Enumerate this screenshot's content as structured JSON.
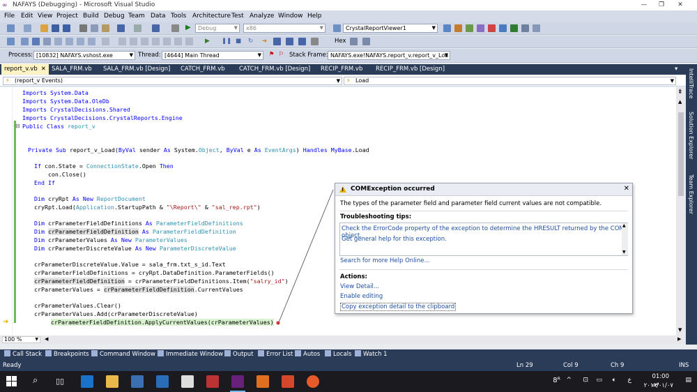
{
  "window": {
    "title": "NAFAYS (Debugging) - Microsoft Visual Studio",
    "min": "—",
    "restore": "❐",
    "close": "✕"
  },
  "menu": [
    "File",
    "Edit",
    "View",
    "Project",
    "Build",
    "Debug",
    "Team",
    "Data",
    "Tools",
    "Architecture",
    "Test",
    "Analyze",
    "Window",
    "Help"
  ],
  "toolbar1": {
    "config": "Debug",
    "platform": "x86",
    "viewer": "CrystalReportViewer1"
  },
  "toolbar2": {
    "hex_label": "Hex"
  },
  "toolbar3": {
    "process_label": "Process:",
    "process_value": "[10832] NAFAYS.vshost.exe",
    "thread_label": "Thread:",
    "thread_value": "[4644] Main Thread",
    "stack_label": "Stack Frame:",
    "stack_value": "NAFAYS.exe!NAFAYS.report_v.report_v_Loa"
  },
  "tabs": [
    {
      "label": "report_v.vb",
      "active": true,
      "close": "✕"
    },
    {
      "label": "SALA_FRM.vb"
    },
    {
      "label": "SALA_FRM.vb [Design]"
    },
    {
      "label": "CATCH_FRM.vb"
    },
    {
      "label": "CATCH_FRM.vb [Design]"
    },
    {
      "label": "RECIP_FRM.vb"
    },
    {
      "label": "RECIP_FRM.vb [Design]"
    }
  ],
  "nav": {
    "left": "(report_v Events)",
    "right": "Load"
  },
  "code": {
    "l1": "Imports System.Data",
    "l2": "Imports System.Data.OleDb",
    "l3": "Imports CrystalDecisions.Shared",
    "l4": "Imports CrystalDecisions.CrystalReports.Engine",
    "l5a": "Public Class ",
    "l5b": "report_v",
    "l6a": "    Private Sub ",
    "l6b": "report_v_Load(",
    "l6c": "ByVal",
    "l6d": " sender ",
    "l6e": "As",
    "l6f": " System.",
    "l6g": "Object",
    "l6h": ", ",
    "l6i": "ByVal",
    "l6j": " e ",
    "l6k": "As",
    "l6l": " ",
    "l6m": "EventArgs",
    "l6n": ") ",
    "l6o": "Handles",
    "l6p": " ",
    "l6q": "MyBase",
    "l6r": ".Load",
    "l7a": "        If",
    "l7b": " con.State = ",
    "l7c": "ConnectionState",
    "l7d": ".Open ",
    "l7e": "Then",
    "l8": "            con.Close()",
    "l9": "        End If",
    "l10a": "        Dim",
    "l10b": " cryRpt ",
    "l10c": "As New",
    "l10d": " ",
    "l10e": "ReportDocument",
    "l11a": "        cryRpt.Load(",
    "l11b": "Application",
    "l11c": ".StartupPath & ",
    "l11d": "\"\\Report\\\"",
    "l11e": " & ",
    "l11f": "\"sal_rep.rpt\"",
    "l11g": ")",
    "l12a": "        Dim",
    "l12b": " crParameterFieldDefinitions ",
    "l12c": "As",
    "l12d": " ",
    "l12e": "ParameterFieldDefinitions",
    "l13a": "        Dim",
    "l13b": " ",
    "l13c": "crParameterFieldDefinition",
    "l13d": " ",
    "l13e": "As",
    "l13f": " ",
    "l13g": "ParameterFieldDefinition",
    "l14a": "        Dim",
    "l14b": " crParameterValues ",
    "l14c": "As New",
    "l14d": " ",
    "l14e": "ParameterValues",
    "l15a": "        Dim",
    "l15b": " crParameterDiscreteValue ",
    "l15c": "As New",
    "l15d": " ",
    "l15e": "ParameterDiscreteValue",
    "l16": "        crParameterDiscreteValue.Value = sala_frm.txt_s_id.Text",
    "l17": "        crParameterFieldDefinitions = cryRpt.DataDefinition.ParameterFields()",
    "l18a": "        ",
    "l18b": "crParameterFieldDefinition",
    "l18c": " = crParameterFieldDefinitions.Item(",
    "l18d": "\"salry_id\"",
    "l18e": ")",
    "l19a": "        crParameterValues = ",
    "l19b": "crParameterFieldDefinition",
    "l19c": ".CurrentValues",
    "l20": "        crParameterValues.Clear()",
    "l21": "        crParameterValues.Add(crParameterDiscreteValue)",
    "l22": "crParameterFieldDefinition.ApplyCurrentValues(crParameterValues)"
  },
  "zoom": "100 %",
  "exception": {
    "title": "COMException occurred",
    "message": "The types of the parameter field and parameter field current values are not compatible.",
    "tips_header": "Troubleshooting tips:",
    "tip1": "Check the ErrorCode property of the exception to determine the HRESULT returned by the COM object.",
    "tip2": "Get general help for this exception.",
    "search": "Search for more Help Online...",
    "actions_header": "Actions:",
    "action1": "View Detail...",
    "action2": "Enable editing",
    "action3": "Copy exception detail to the clipboard"
  },
  "side_tabs": [
    "IntelliTrace",
    "Solution Explorer",
    "Team Explorer"
  ],
  "tool_tabs": [
    "Call Stack",
    "Breakpoints",
    "Command Window",
    "Immediate Window",
    "Output",
    "Error List",
    "Autos",
    "Locals",
    "Watch 1"
  ],
  "status": {
    "ready": "Ready",
    "ln": "Ln 29",
    "col": "Col 9",
    "ch": "Ch 9",
    "ins": "INS"
  },
  "tray": {
    "time": "01:00 ص",
    "date": "٢٠١٩/٠١/٠٧",
    "lang": "ع",
    "num": "8"
  },
  "colors": {
    "accent": "#2b3c59",
    "active_tab": "#fff3c4",
    "keyword": "#0000ff",
    "type": "#2b91af",
    "string": "#a31515"
  }
}
